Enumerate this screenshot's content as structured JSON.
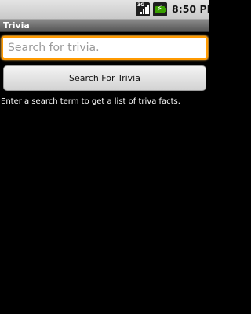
{
  "status_bar": {
    "time": "8:50",
    "ampm": "PM",
    "signal_label": "3G",
    "icons": [
      "signal-icon",
      "battery-charging-icon"
    ],
    "battery_color": "#39a000"
  },
  "app": {
    "title": "Trivia"
  },
  "search": {
    "value": "",
    "placeholder": "Search for trivia.",
    "focus_color": "#ff9a00"
  },
  "button": {
    "label": "Search For Trivia"
  },
  "hint": {
    "text": "Enter a search term to get a list of triva facts."
  }
}
